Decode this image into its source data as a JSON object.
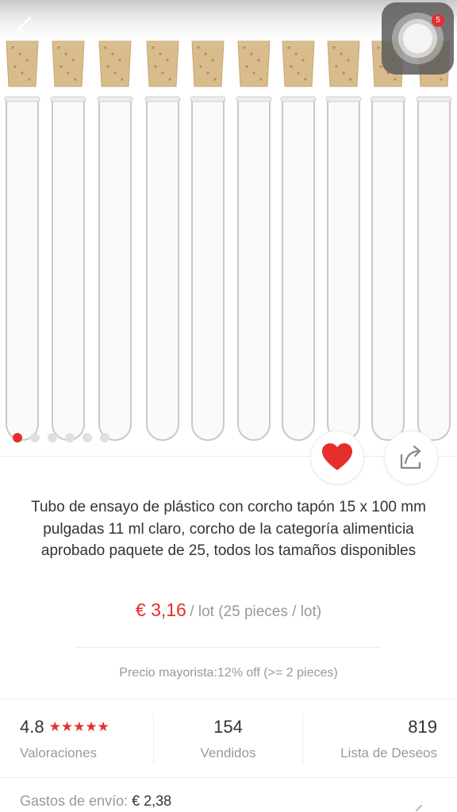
{
  "header": {
    "back_icon": "chevron-left-icon",
    "assistive_badge": "5"
  },
  "gallery": {
    "image_count": 6,
    "active_index": 0,
    "subject": "test-tubes-with-cork"
  },
  "actions": {
    "favorite_icon": "heart-icon",
    "share_icon": "share-icon"
  },
  "product": {
    "title": "Tubo de ensayo de plástico con corcho tapón 15 x 100 mm pulgadas 11 ml claro, corcho de la categoría alimenticia aprobado paquete de 25, todos los tamaños disponibles",
    "price": "€ 3,16",
    "unit": "/ lot (25 pieces / lot)",
    "wholesale": "Precio mayorista:12% off (>= 2 pieces)"
  },
  "stats": {
    "rating_value": "4.8",
    "rating_stars": "★★★★★",
    "rating_label": "Valoraciones",
    "sold_value": "154",
    "sold_label": "Vendidos",
    "wishlist_value": "819",
    "wishlist_label": "Lista de Deseos"
  },
  "shipping": {
    "label": "Gastos de envío:",
    "value": "€ 2,38"
  },
  "colors": {
    "accent": "#e62e2e",
    "muted_text": "#999999",
    "cork": "#d9bc8c"
  }
}
